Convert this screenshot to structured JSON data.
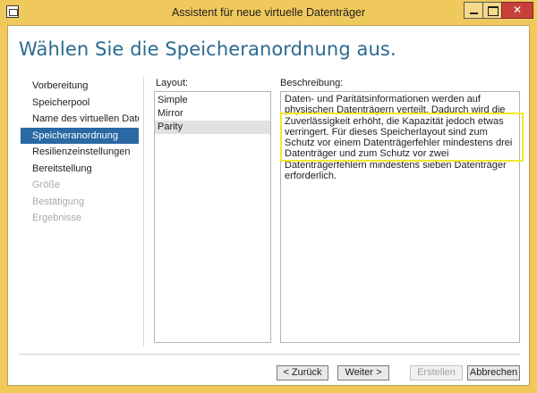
{
  "window": {
    "title": "Assistent für neue virtuelle Datenträger"
  },
  "heading": "Wählen Sie die Speicheranordnung aus.",
  "nav": {
    "items": [
      {
        "label": "Vorbereitung",
        "state": "normal"
      },
      {
        "label": "Speicherpool",
        "state": "normal"
      },
      {
        "label": "Name des virtuellen Date...",
        "state": "normal"
      },
      {
        "label": "Speicheranordnung",
        "state": "active"
      },
      {
        "label": "Resilienzeinstellungen",
        "state": "normal"
      },
      {
        "label": "Bereitstellung",
        "state": "normal"
      },
      {
        "label": "Größe",
        "state": "disabled"
      },
      {
        "label": "Bestätigung",
        "state": "disabled"
      },
      {
        "label": "Ergebnisse",
        "state": "disabled"
      }
    ]
  },
  "layout": {
    "label": "Layout:",
    "options": [
      "Simple",
      "Mirror",
      "Parity"
    ],
    "selected": "Parity"
  },
  "description": {
    "label": "Beschreibung:",
    "text": "Daten- und Paritätsinformationen werden auf physischen Datenträgern verteilt. Dadurch wird die Zuverlässigkeit erhöht, die Kapazität jedoch etwas verringert. Für dieses Speicherlayout sind zum Schutz vor einem Datenträgerfehler mindestens drei Datenträger und zum Schutz vor zwei Datenträgerfehlern mindestens sieben Datenträger erforderlich."
  },
  "buttons": {
    "back": "< Zurück",
    "next": "Weiter >",
    "finish": "Erstellen",
    "cancel": "Abbrechen"
  },
  "colors": {
    "accent": "#2a69a4",
    "heading": "#2b6a8f",
    "window_frame": "#f0c95c",
    "highlight_box": "#f0ea2a",
    "close_button": "#c7403a"
  },
  "icons": {
    "app": "window-icon",
    "minimize": "minimize-icon",
    "maximize": "maximize-icon",
    "close": "close-icon"
  }
}
